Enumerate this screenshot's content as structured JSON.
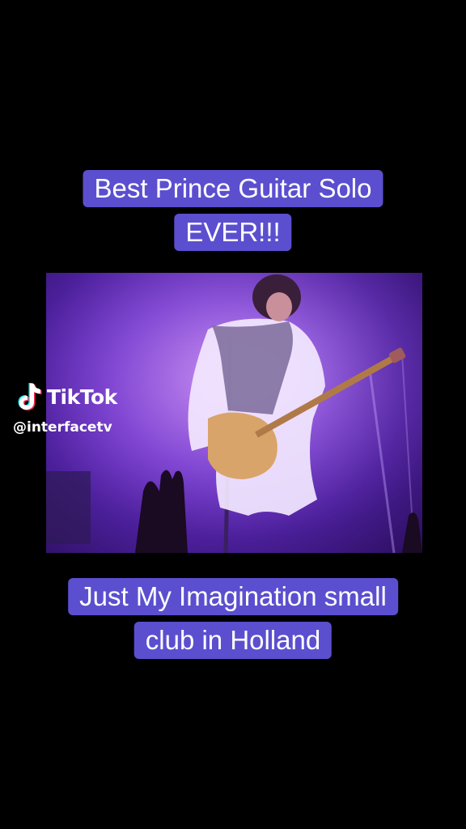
{
  "captions": {
    "top": [
      "Best Prince Guitar Solo",
      "EVER!!!"
    ],
    "bottom": [
      "Just My Imagination small",
      "club in Holland"
    ]
  },
  "watermark": {
    "brand": "TikTok",
    "handle": "@interfacetv",
    "icon": "tiktok-note-icon"
  },
  "colors": {
    "caption_bg": "#5b4fcf",
    "caption_text": "#ffffff",
    "background": "#000000"
  }
}
